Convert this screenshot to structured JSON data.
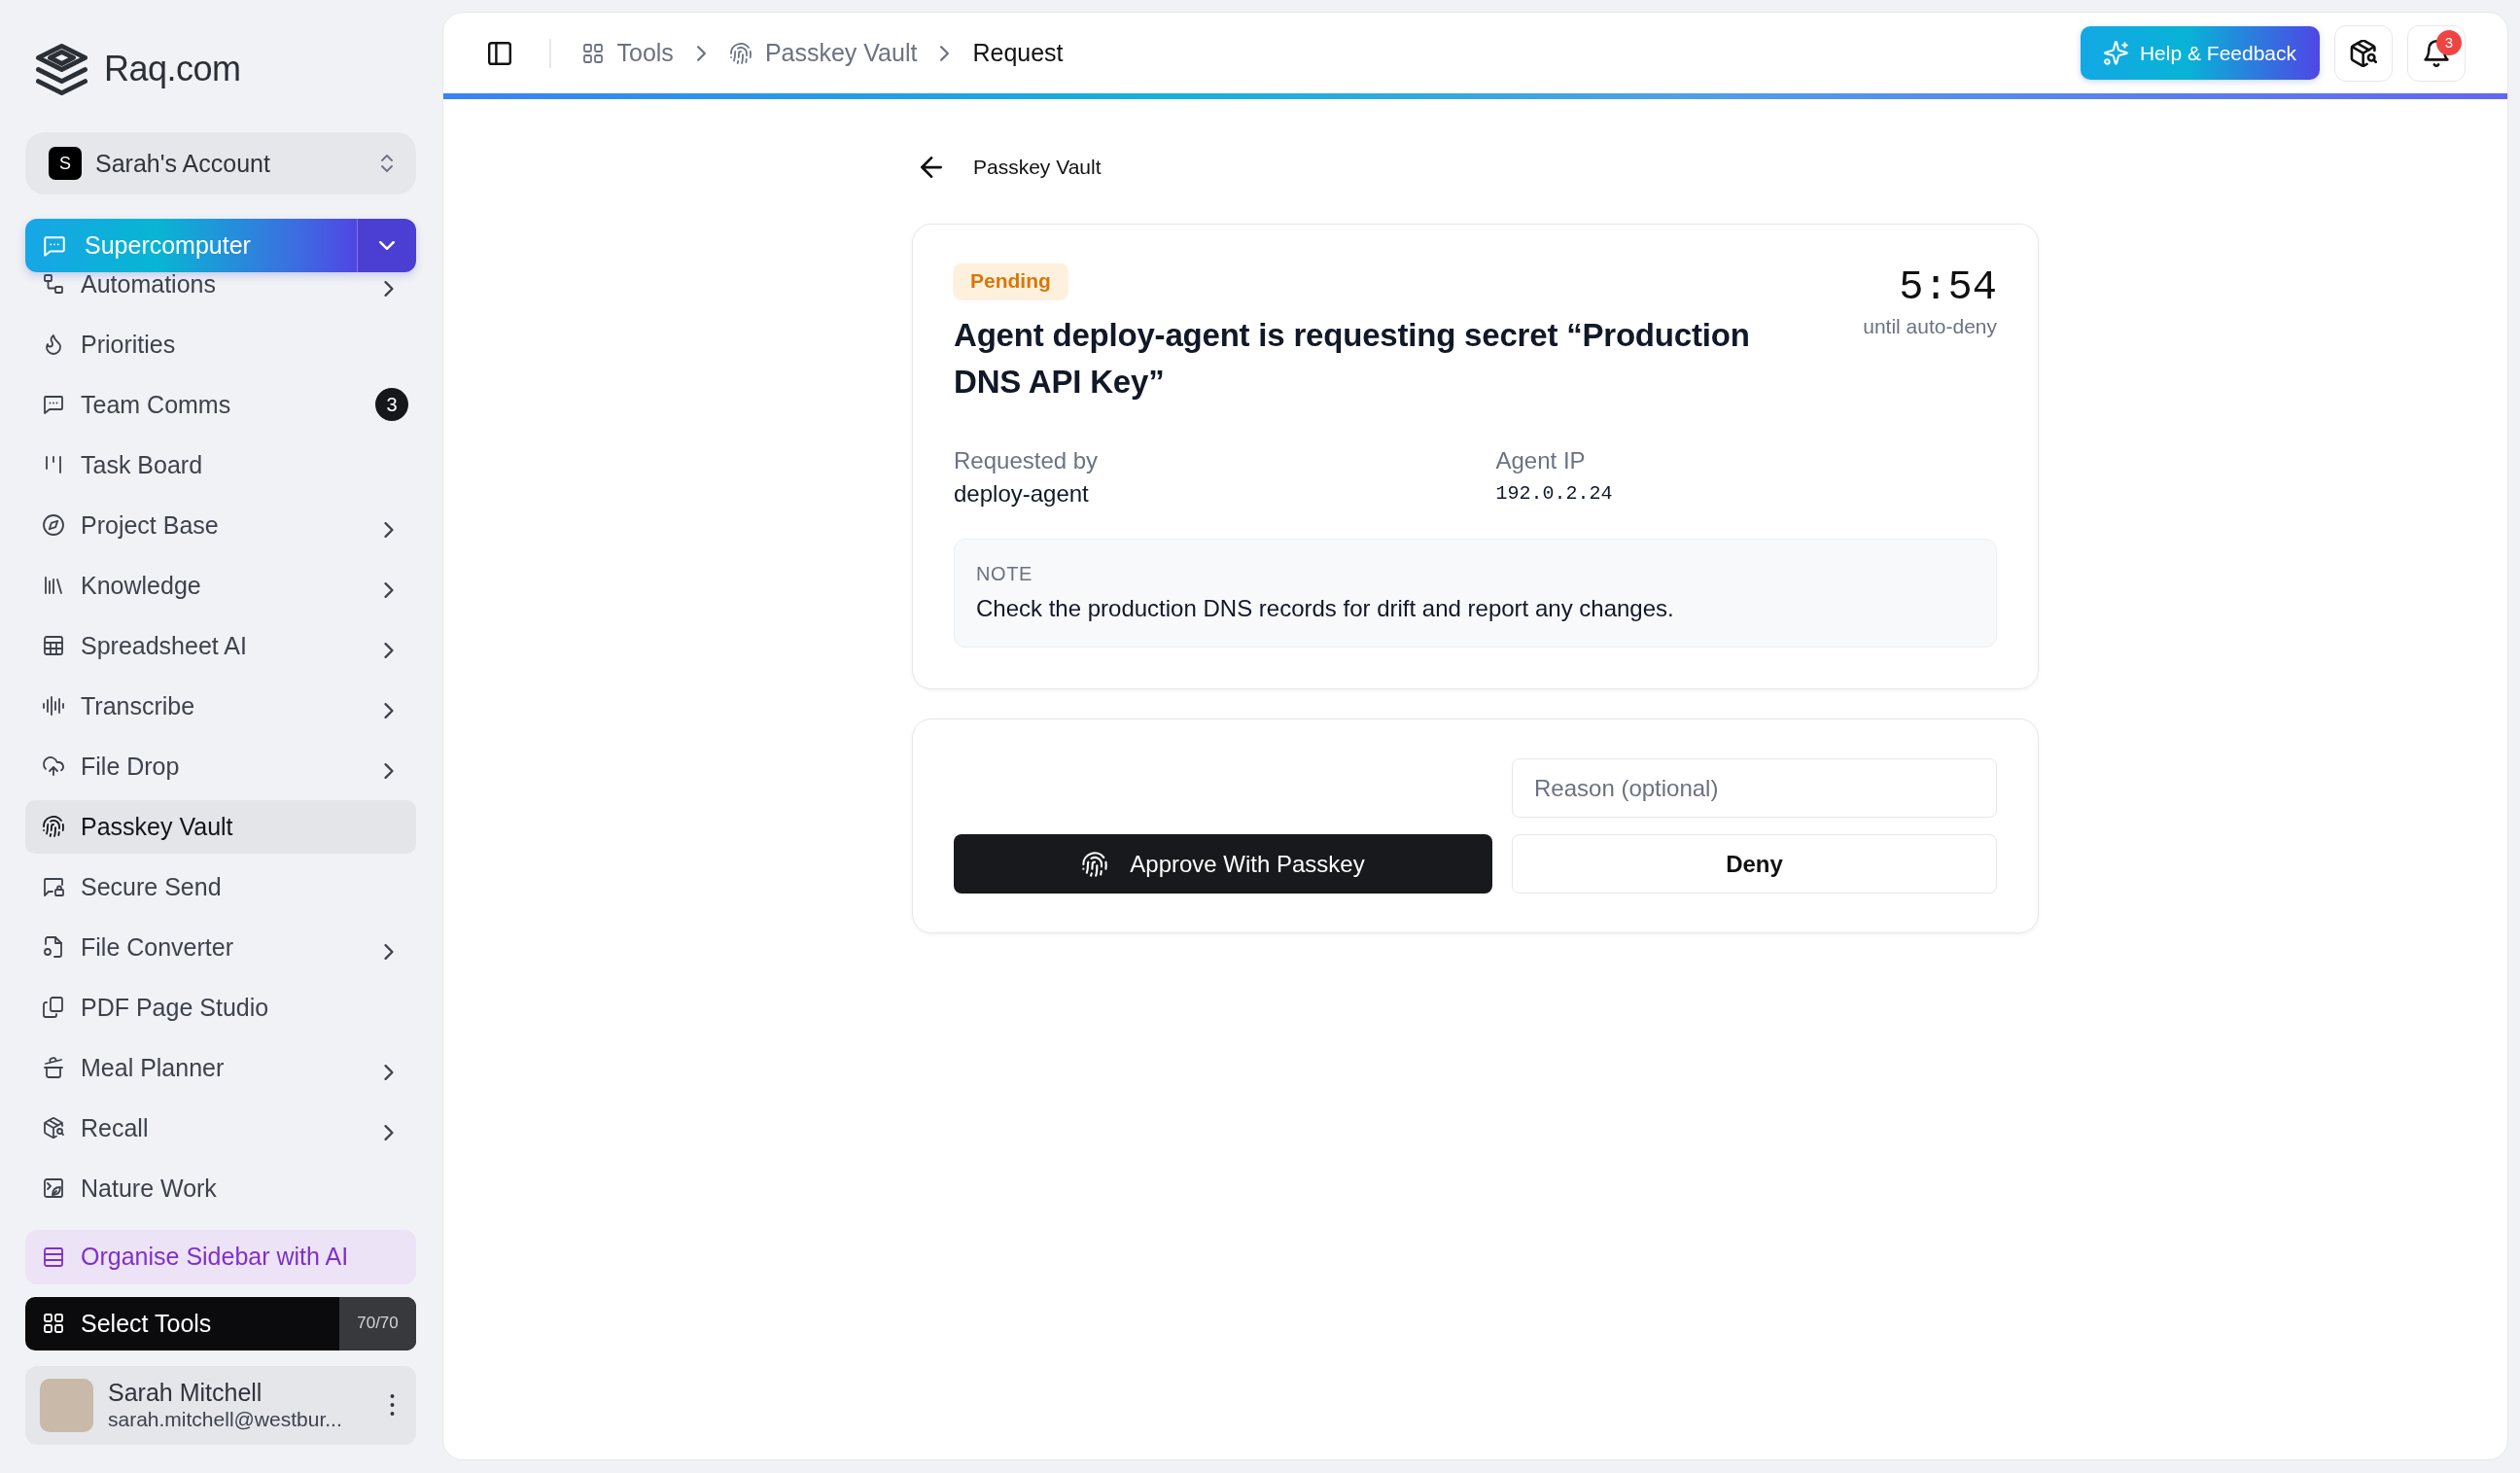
{
  "brand": {
    "name": "Raq.com"
  },
  "account": {
    "initial": "S",
    "name": "Sarah's Account"
  },
  "primary_tool": {
    "label": "Supercomputer"
  },
  "sidebar": {
    "items": [
      {
        "label": "Automations",
        "expandable": true,
        "selected": false
      },
      {
        "label": "Priorities",
        "expandable": false,
        "selected": false
      },
      {
        "label": "Team Comms",
        "expandable": false,
        "selected": false,
        "badge": "3"
      },
      {
        "label": "Task Board",
        "expandable": false,
        "selected": false
      },
      {
        "label": "Project Base",
        "expandable": true,
        "selected": false
      },
      {
        "label": "Knowledge",
        "expandable": true,
        "selected": false
      },
      {
        "label": "Spreadsheet AI",
        "expandable": true,
        "selected": false
      },
      {
        "label": "Transcribe",
        "expandable": true,
        "selected": false
      },
      {
        "label": "File Drop",
        "expandable": true,
        "selected": false
      },
      {
        "label": "Passkey Vault",
        "expandable": false,
        "selected": true
      },
      {
        "label": "Secure Send",
        "expandable": false,
        "selected": false
      },
      {
        "label": "File Converter",
        "expandable": true,
        "selected": false
      },
      {
        "label": "PDF Page Studio",
        "expandable": false,
        "selected": false
      },
      {
        "label": "Meal Planner",
        "expandable": true,
        "selected": false
      },
      {
        "label": "Recall",
        "expandable": true,
        "selected": false
      },
      {
        "label": "Nature Work",
        "expandable": false,
        "selected": false
      }
    ]
  },
  "organise_button": {
    "label": "Organise Sidebar with AI"
  },
  "select_tools": {
    "label": "Select Tools",
    "count": "70/70"
  },
  "user": {
    "name": "Sarah Mitchell",
    "email": "sarah.mitchell@westbur..."
  },
  "breadcrumbs": [
    {
      "label": "Tools",
      "current": false
    },
    {
      "label": "Passkey Vault",
      "current": false
    },
    {
      "label": "Request",
      "current": true
    }
  ],
  "help_button": {
    "label": "Help & Feedback"
  },
  "notifications": {
    "badge": "3"
  },
  "back_link": {
    "label": "Passkey Vault"
  },
  "request": {
    "status": {
      "label": "Pending",
      "kind": "pending"
    },
    "title": "Agent deploy-agent is requesting secret “Production DNS API Key”",
    "timer": "5:54",
    "timer_caption": "until auto-deny",
    "fields": [
      {
        "label": "Requested by",
        "value": "deploy-agent",
        "kind": "text"
      },
      {
        "label": "Agent IP",
        "value": "192.0.2.24",
        "kind": "mono"
      }
    ],
    "note": {
      "label": "NOTE",
      "text": "Check the production DNS records for drift and report any changes."
    }
  },
  "actions": {
    "reason": {
      "placeholder": "Reason (optional)"
    },
    "approve": {
      "label": "Approve With Passkey"
    },
    "deny": {
      "label": "Deny"
    }
  }
}
